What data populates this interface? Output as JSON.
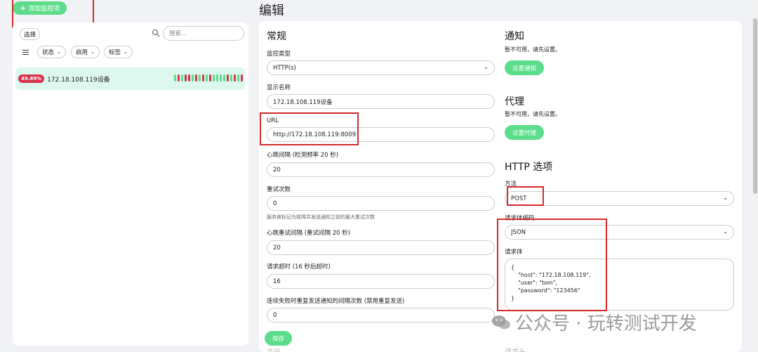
{
  "toolbar": {
    "add_monitor": "添加监控项"
  },
  "sidebar": {
    "select_label": "选择",
    "search_placeholder": "搜索...",
    "filters": [
      {
        "label": "状态"
      },
      {
        "label": "启用"
      },
      {
        "label": "标签"
      }
    ],
    "monitor": {
      "uptime": "49.89%",
      "name": "172.18.108.119设备",
      "beats": [
        "up",
        "down",
        "up",
        "down",
        "down",
        "up",
        "down",
        "up",
        "down",
        "up",
        "down",
        "up",
        "up",
        "up",
        "up",
        "down",
        "up",
        "down",
        "up",
        "down"
      ]
    }
  },
  "page": {
    "title": "编辑"
  },
  "general": {
    "title": "常规",
    "monitor_type_label": "监控类型",
    "monitor_type_value": "HTTP(s)",
    "display_name_label": "显示名称",
    "display_name_value": "172.18.108.119设备",
    "url_label": "URL",
    "url_value": "http://172.18.108.119:8009",
    "heartbeat_label": "心跳间隔 (检测频率 20 秒)",
    "heartbeat_value": "20",
    "retries_label": "重试次数",
    "retries_value": "0",
    "retries_hint": "服务被标记为故障并发送通知之前的最大重试次数",
    "retry_interval_label": "心跳重试间隔 (重试间隔 20 秒)",
    "retry_interval_value": "20",
    "timeout_label": "请求超时 (16 秒后超时)",
    "timeout_value": "16",
    "resend_label": "连续失败时重复发送通知的间隔次数 (禁用重复发送)",
    "resend_value": "0",
    "save_label": "保存",
    "cut_off_left": "高级"
  },
  "notification": {
    "title": "通知",
    "note": "暂不可用，请先设置。",
    "button": "设置通知"
  },
  "proxy": {
    "title": "代理",
    "note": "暂不可用，请先设置。",
    "button": "设置代理"
  },
  "http_options": {
    "title": "HTTP 选项",
    "method_label": "方法",
    "method_value": "POST",
    "body_encoding_label": "请求体编码",
    "body_encoding_value": "JSON",
    "body_label": "请求体",
    "body_lines": [
      "{",
      "    \"host\": \"172.18.108.119\",",
      "    \"user\": \"tom\",",
      "    \"password\": \"123456\"",
      "}"
    ],
    "cut_off_right": "请求头"
  },
  "watermark": {
    "text": "公众号 · 玩转测试开发"
  },
  "colors": {
    "accent_green": "#5cdd8b",
    "badge_red": "#d8324a",
    "annotation_red": "#d42a2a",
    "selected_row": "#dcf8ee"
  }
}
